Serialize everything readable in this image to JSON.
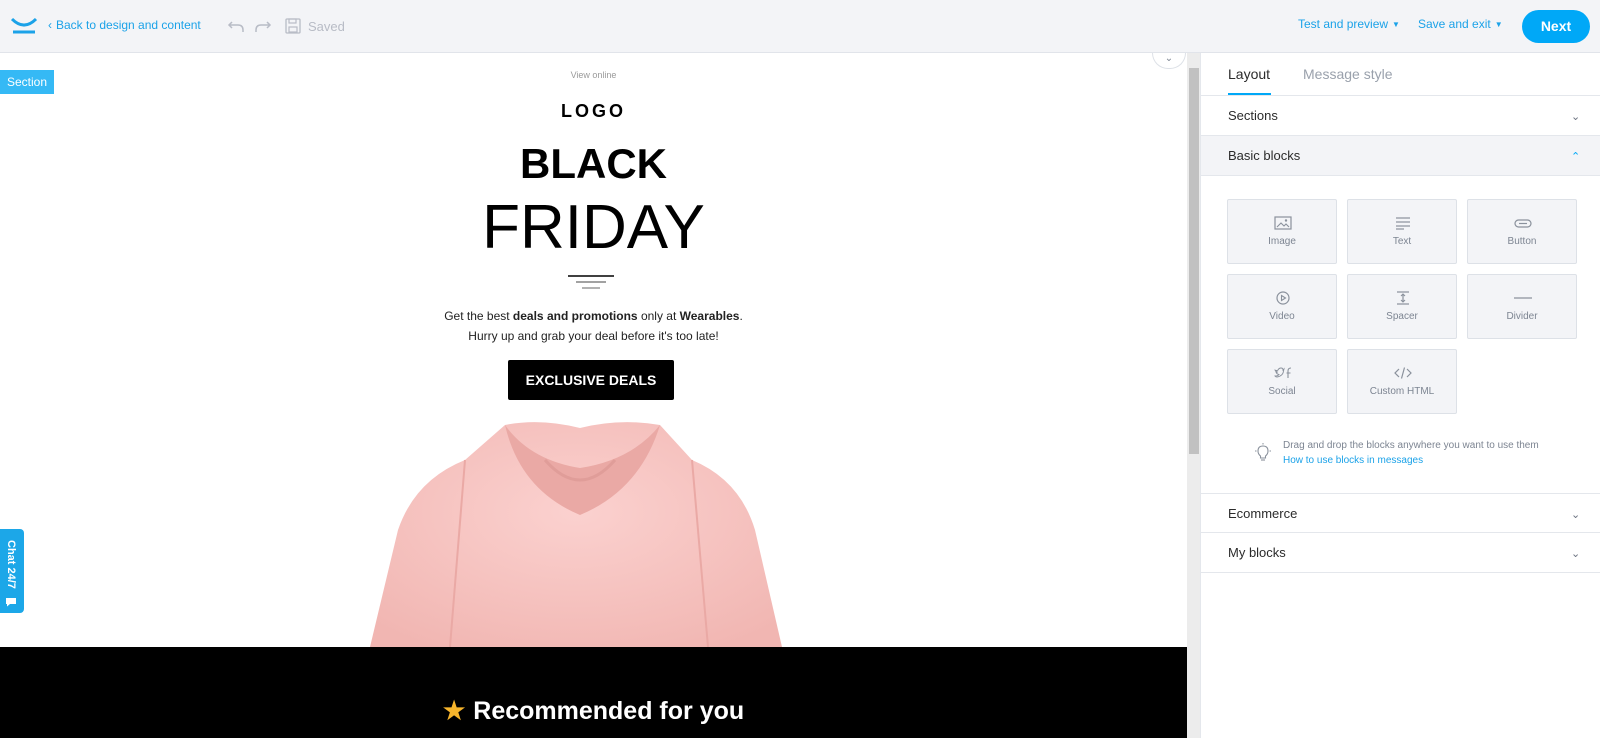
{
  "topbar": {
    "back_label": "Back to design and content",
    "saved_label": "Saved",
    "test_preview_label": "Test and preview",
    "save_exit_label": "Save and exit",
    "next_label": "Next",
    "accent_color": "#00a8f7"
  },
  "canvas": {
    "section_tag": "Section",
    "view_online": "View online",
    "logo_text": "LOGO",
    "headline_1": "BLACK",
    "headline_2": "FRIDAY",
    "promo_line1_pre": "Get the best ",
    "promo_line1_bold1": "deals and promotions",
    "promo_line1_mid": " only at ",
    "promo_line1_bold2": "Wearables",
    "promo_line1_end": ".",
    "promo_line2": "Hurry up and grab your deal before it's too late!",
    "cta_label": "EXCLUSIVE DEALS",
    "recommended_heading": "Recommended for you",
    "recommended_icon": "star-icon",
    "chat_label": "Chat 24/7"
  },
  "panel": {
    "tabs": [
      {
        "label": "Layout",
        "active": true
      },
      {
        "label": "Message style",
        "active": false
      }
    ],
    "accordions": {
      "sections": "Sections",
      "basic_blocks": "Basic blocks",
      "ecommerce": "Ecommerce",
      "my_blocks": "My blocks"
    },
    "blocks": [
      {
        "label": "Image",
        "icon": "image-icon"
      },
      {
        "label": "Text",
        "icon": "text-icon"
      },
      {
        "label": "Button",
        "icon": "button-icon"
      },
      {
        "label": "Video",
        "icon": "video-icon"
      },
      {
        "label": "Spacer",
        "icon": "spacer-icon"
      },
      {
        "label": "Divider",
        "icon": "divider-icon"
      },
      {
        "label": "Social",
        "icon": "social-icon"
      },
      {
        "label": "Custom HTML",
        "icon": "code-icon"
      }
    ],
    "hint_text": "Drag and drop the blocks anywhere you want to use them",
    "hint_link": "How to use blocks in messages"
  }
}
